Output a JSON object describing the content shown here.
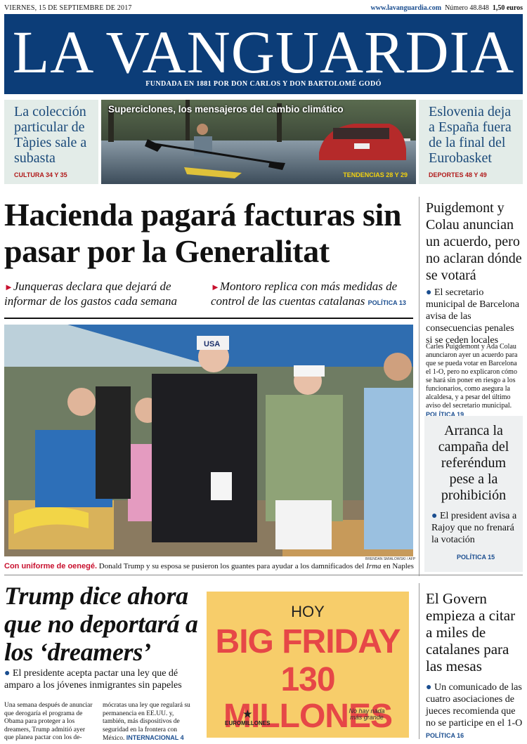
{
  "topbar": {
    "date": "VIERNES, 15 DE SEPTIEMBRE DE 2017",
    "url": "www.lavanguardia.com",
    "number": "Número 48.848",
    "price": "1,50 euros"
  },
  "masthead": {
    "title": "LA VANGUARDIA",
    "founded": "FUNDADA EN 1881 POR DON CARLOS Y DON BARTOLOMÉ GODÓ"
  },
  "teasers": {
    "left": {
      "title": "La colección particular de Tàpies sale a subasta",
      "section": "CULTURA 34 Y 35"
    },
    "center": {
      "title": "Superciclones, los mensajeros del cambio climático",
      "section": "TENDENCIAS 28 Y 29"
    },
    "right": {
      "title": "Eslovenia deja a España fuera de la final del Eurobasket",
      "section": "DEPORTES 48 Y 49"
    }
  },
  "lead": {
    "headline": "Hacienda pagará facturas sin pasar por la Generalitat",
    "sub1": "Junqueras declara que dejará de informar de los gastos cada semana",
    "sub2": "Montoro replica con más medidas de control de las cuentas catalanas",
    "section": "POLÍTICA 13"
  },
  "right1": {
    "headline": "Puigdemont y Colau anuncian un acuerdo, pero no aclaran dónde se votará",
    "bullet": "El secretario municipal de Barcelona avisa de las consecuencias penales si se ceden locales",
    "body": "Carles Puigdemont y Ada Colau anunciaron ayer un acuerdo para que se pueda votar en Barcelona el 1-O, pero no explicaron cómo se hará sin poner en riesgo a los funcionarios, como asegura la alcaldesa, y a pesar del último aviso del secretario municipal.",
    "section": "POLÍTICA 19"
  },
  "right2": {
    "headline": "Arranca la campaña del referéndum pese a la prohibición",
    "bullet": "El president avisa a Rajoy que no frenará la votación",
    "section": "POLÍTICA 15"
  },
  "photo": {
    "credit": "BRENDAN SMIALOWSKI / AFP",
    "cap_lead": "Con uniforme de oenegé.",
    "cap_text": "Donald Trump y su esposa se pusieron los guantes para ayudar a los damnificados del",
    "cap_italic": "Irma",
    "cap_end": "en Naples",
    "hat": "USA"
  },
  "bottom": {
    "headline": "Trump dice ahora que no deportará a los ‘dreamers’",
    "bullet": "El presidente acepta pactar una ley que dé amparo a los jóvenes inmigrantes sin papeles",
    "col1": "Una semana después de anunciar que derogaría el programa de Obama para proteger a los dreamers, Trump admitió ayer que planea pactar con los de-",
    "col2": "mócratas una ley que regulará su permanencia en EE.UU. y, también, más dispositivos de seguridad en la frontera con México.",
    "section": "INTERNACIONAL 4"
  },
  "ad": {
    "hoy": "HOY",
    "line1": "BIG FRIDAY",
    "line2": "130 MILLONES",
    "brand": "EUROMILLONES",
    "tag": "No hay nada más grande"
  },
  "right3": {
    "headline": "El Govern empieza a citar a miles de catalanes para las mesas",
    "bullet": "Un comunicado de las cuatro asociaciones de jueces recomienda que no se participe en el 1-O",
    "section": "POLÍTICA 16"
  },
  "colors": {
    "brand": "#0c3d78",
    "accent": "#c8102e",
    "link": "#1a4d8f",
    "ad": "#f7cd6a"
  }
}
